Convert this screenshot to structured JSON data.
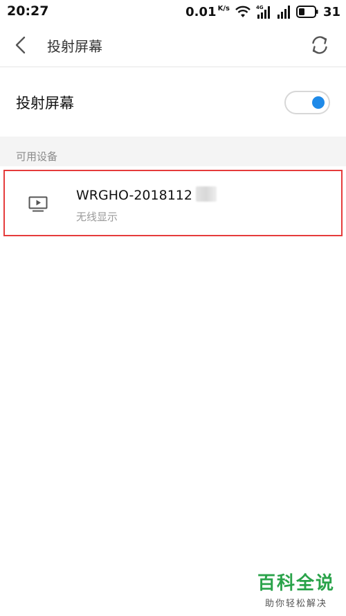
{
  "status_bar": {
    "time": "20:27",
    "net_speed": "0.01",
    "net_unit": "K/s",
    "signal_label": "4G",
    "battery": "31",
    "icons": [
      "wifi-icon",
      "signal-4g-icon",
      "signal-icon",
      "battery-icon"
    ]
  },
  "header": {
    "title": "投射屏幕",
    "back_icon": "chevron-left-icon",
    "refresh_icon": "refresh-icon"
  },
  "setting": {
    "label": "投射屏幕",
    "enabled": true,
    "accent_color": "#1f8ae8"
  },
  "available_devices": {
    "section_title": "可用设备",
    "items": [
      {
        "name": "WRGHO-2018112",
        "subtitle": "无线显示",
        "icon": "tv-icon"
      }
    ]
  },
  "watermark": {
    "main": "百科全说",
    "sub": "助你轻松解决"
  }
}
